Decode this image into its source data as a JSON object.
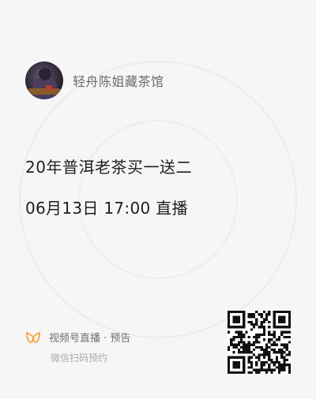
{
  "host": {
    "name": "轻舟陈姐藏茶馆"
  },
  "event": {
    "title": "20年普洱老茶买一送二",
    "schedule": "06月13日 17:00 直播"
  },
  "footer": {
    "brand_label": "视频号直播 · 预告",
    "hint": "微信扫码预约"
  },
  "colors": {
    "brand_orange": "#f3a53b",
    "card_background": "#f6f6f7",
    "title_text": "#1e1e1e"
  },
  "icons": {
    "brand": "wechat-channels-butterfly-icon",
    "qr": "qr-code"
  }
}
